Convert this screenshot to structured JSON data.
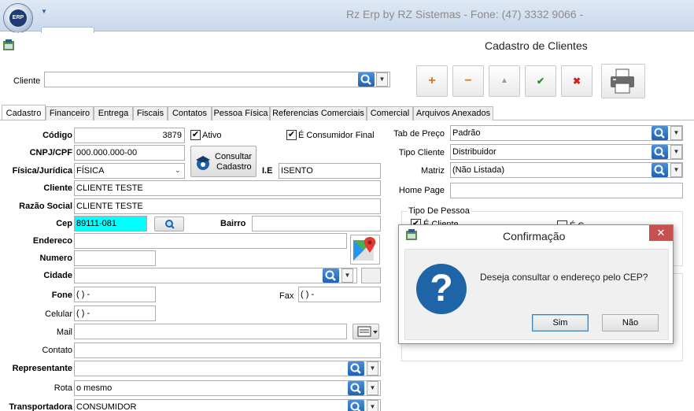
{
  "app": {
    "title": "Rz Erp by RZ Sistemas - Fone: (47) 3332 9066 -",
    "orb_text": "ERP RZ",
    "form_title": "Cadastro de Clientes"
  },
  "search": {
    "label": "Cliente",
    "value": ""
  },
  "toolbar": {
    "add": "+",
    "remove": "−",
    "up": "▲",
    "confirm": "✔",
    "cancel": "✖"
  },
  "tabs": [
    {
      "label": "Cadastro",
      "active": true
    },
    {
      "label": "Financeiro"
    },
    {
      "label": "Entrega"
    },
    {
      "label": "Fiscais"
    },
    {
      "label": "Contatos"
    },
    {
      "label": "Pessoa Física"
    },
    {
      "label": "Referencias Comerciais"
    },
    {
      "label": "Comercial"
    },
    {
      "label": "Arquivos Anexados"
    }
  ],
  "form": {
    "codigo": {
      "label": "Código",
      "value": "3879"
    },
    "ativo": {
      "label": "Ativo",
      "checked": true
    },
    "consumidor_final": {
      "label": "É Consumidor Final",
      "checked": true
    },
    "cnpj": {
      "label": "CNPJ/CPF",
      "value": "000.000.000-00"
    },
    "consultar": {
      "label_1": "Consultar",
      "label_2": "Cadastro"
    },
    "fisica_juridica": {
      "label": "Física/Jurídica",
      "value": "FÍSICA"
    },
    "ie": {
      "label": "I.E",
      "value": "ISENTO"
    },
    "cliente": {
      "label": "Cliente",
      "value": "CLIENTE TESTE"
    },
    "razao_social": {
      "label": "Razão Social",
      "value": "CLIENTE TESTE"
    },
    "cep": {
      "label": "Cep",
      "value": "89111-081"
    },
    "bairro": {
      "label": "Bairro",
      "value": ""
    },
    "endereco": {
      "label": "Endereco",
      "value": ""
    },
    "numero": {
      "label": "Numero",
      "value": ""
    },
    "cidade": {
      "label": "Cidade",
      "value": ""
    },
    "fone": {
      "label": "Fone",
      "value": "(  )    -"
    },
    "fax": {
      "label": "Fax",
      "value": "(  )    -"
    },
    "celular": {
      "label": "Celular",
      "value": "(  )    -"
    },
    "mail": {
      "label": "Mail",
      "value": ""
    },
    "contato": {
      "label": "Contato",
      "value": ""
    },
    "representante": {
      "label": "Representante",
      "value": ""
    },
    "rota": {
      "label": "Rota",
      "value": "o mesmo"
    },
    "transportadora": {
      "label": "Transportadora",
      "value": "CONSUMIDOR"
    }
  },
  "right": {
    "tab_preco": {
      "label": "Tab de Preço",
      "value": "Padrão"
    },
    "tipo_cliente": {
      "label": "Tipo Cliente",
      "value": "Distribuidor"
    },
    "matriz": {
      "label": "Matriz",
      "value": "(Não Listada)"
    },
    "home_page": {
      "label": "Home Page",
      "value": ""
    },
    "tipo_pessoa": {
      "title": "Tipo De Pessoa",
      "e_cliente": "É Cliente",
      "e_other": "É C"
    }
  },
  "dialog": {
    "title": "Confirmação",
    "message": "Deseja consultar o endereço pelo CEP?",
    "yes": "Sim",
    "no": "Não",
    "close": "✕"
  },
  "colors": {
    "cep_highlight": "#00ffff",
    "search_blue": "#1f62b4",
    "close_red": "#c75050"
  }
}
